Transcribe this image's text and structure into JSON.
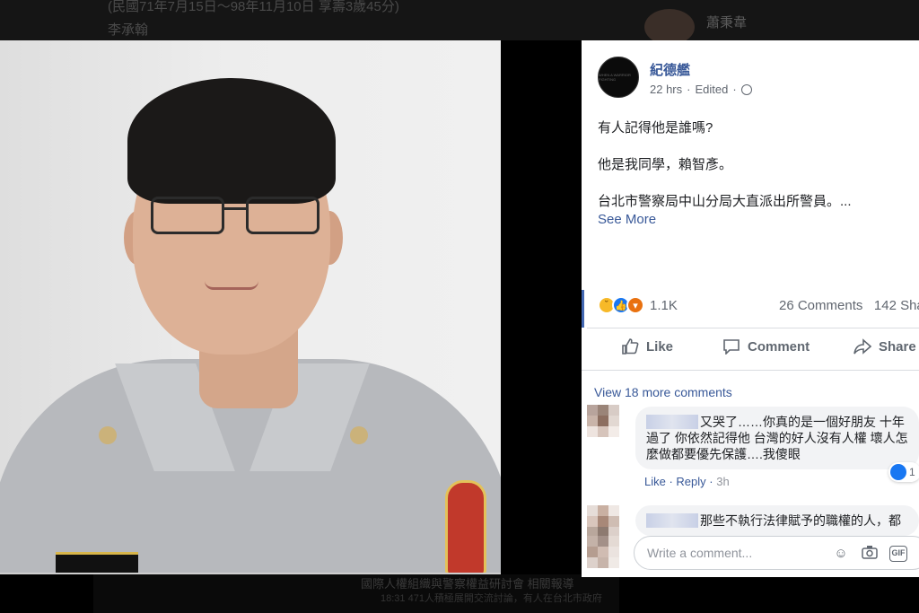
{
  "background_page": {
    "line1": "(民國71年7月15日～98年11月10日 享壽3歲45分)",
    "line2": "李承翰",
    "right_name": "蕭秉韋",
    "bottom_text": "國際人權組織與警察權益研討會 相關報導",
    "bottom_text2": "18:31 471人積極展開交流討論，有人在台北市政府"
  },
  "post": {
    "author": "紀德艦",
    "time": "22 hrs",
    "edited": "Edited",
    "paragraphs": [
      "有人記得他是誰嗎?",
      "他是我同學，賴智彥。",
      "台北市警察局中山分局大直派出所警員。..."
    ],
    "see_more": "See More",
    "avatar_text": "WHEN A WARRIOR FIGHTING",
    "reaction_count": "1.1K",
    "comments_count": "26 Comments",
    "shares_count": "142 Sha",
    "reaction_icons": [
      "sad-emoji-icon",
      "like-icon",
      "angry-emoji-icon"
    ]
  },
  "actions": {
    "like": "Like",
    "comment": "Comment",
    "share": "Share"
  },
  "comments": {
    "view_more": "View 18 more comments",
    "items": [
      {
        "text": "又哭了……你真的是一個好朋友 十年過了 你依然記得他 台灣的好人沒有人權 壞人怎麼做都要優先保護….我傻眼",
        "like_label": "Like",
        "reply_label": "Reply",
        "time": "3h",
        "likes": "1"
      },
      {
        "text": "那些不執行法律賦予的職權的人，都"
      }
    ],
    "write_placeholder": "Write a comment..."
  },
  "colors": {
    "link": "#385898",
    "like_blue": "#1877f2",
    "panel_bg": "#ffffff",
    "overlay_bg": "#000000"
  }
}
